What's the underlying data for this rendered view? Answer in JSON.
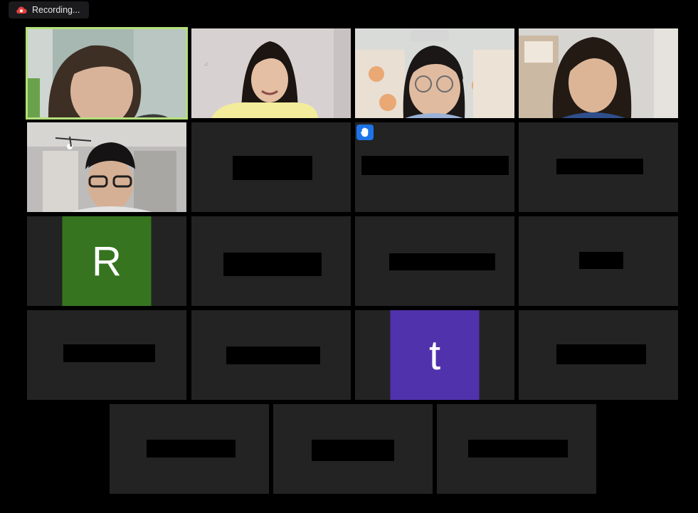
{
  "recording": {
    "label": "Recording...",
    "icon": "cloud-record-icon",
    "color": "#e3423c"
  },
  "colors": {
    "active_border": "#b4e07a",
    "tile_bg": "#232323",
    "raise_hand": "#1e73e8"
  },
  "participants": [
    {
      "type": "video",
      "speaking": true
    },
    {
      "type": "video"
    },
    {
      "type": "video"
    },
    {
      "type": "video"
    },
    {
      "type": "video"
    },
    {
      "type": "name-hidden"
    },
    {
      "type": "name-hidden",
      "raised_hand": true,
      "icon": "raised-hand-icon"
    },
    {
      "type": "name-hidden"
    },
    {
      "type": "avatar",
      "initial": "R",
      "color": "#367420"
    },
    {
      "type": "name-hidden"
    },
    {
      "type": "name-hidden"
    },
    {
      "type": "name-hidden"
    },
    {
      "type": "name-hidden"
    },
    {
      "type": "name-hidden"
    },
    {
      "type": "avatar",
      "initial": "t",
      "color": "#5132ad"
    },
    {
      "type": "name-hidden"
    },
    {
      "type": "name-hidden"
    },
    {
      "type": "name-hidden"
    },
    {
      "type": "name-hidden"
    }
  ]
}
